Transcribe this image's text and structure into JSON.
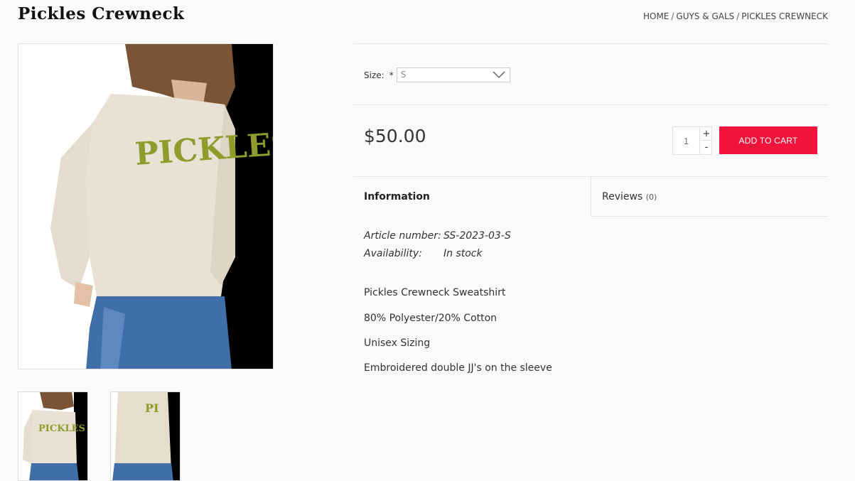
{
  "page": {
    "title": "Pickles Crewneck"
  },
  "breadcrumb": [
    {
      "label": "HOME"
    },
    {
      "label": "GUYS & GALS"
    },
    {
      "label": "PICKLES CREWNECK"
    }
  ],
  "breadcrumb_separator": "/",
  "product_images": {
    "main": {
      "icon": "product-photo-sweatshirt",
      "print": "PICKLES"
    },
    "thumbnails": [
      {
        "icon": "thumbnail-front",
        "print": "PICKLES"
      },
      {
        "icon": "thumbnail-side",
        "print": "PI"
      }
    ]
  },
  "options": {
    "size_label": "Size:",
    "required_mark": "*",
    "size_selected": "S"
  },
  "price": "$50.00",
  "cart": {
    "quantity": "1",
    "plus_label": "+",
    "minus_label": "-",
    "add_label": "Add to cart",
    "button_color": "#f0133a"
  },
  "tabs": {
    "information": "Information",
    "reviews": "Reviews",
    "reviews_count": "(0)"
  },
  "specs": [
    {
      "label": "Article number:",
      "value": "SS-2023-03-S"
    },
    {
      "label": "Availability:",
      "value": "In stock"
    }
  ],
  "description": [
    "Pickles Crewneck Sweatshirt",
    "80% Polyester/20% Cotton",
    "Unisex Sizing",
    "Embroidered double JJ's on the sleeve"
  ]
}
